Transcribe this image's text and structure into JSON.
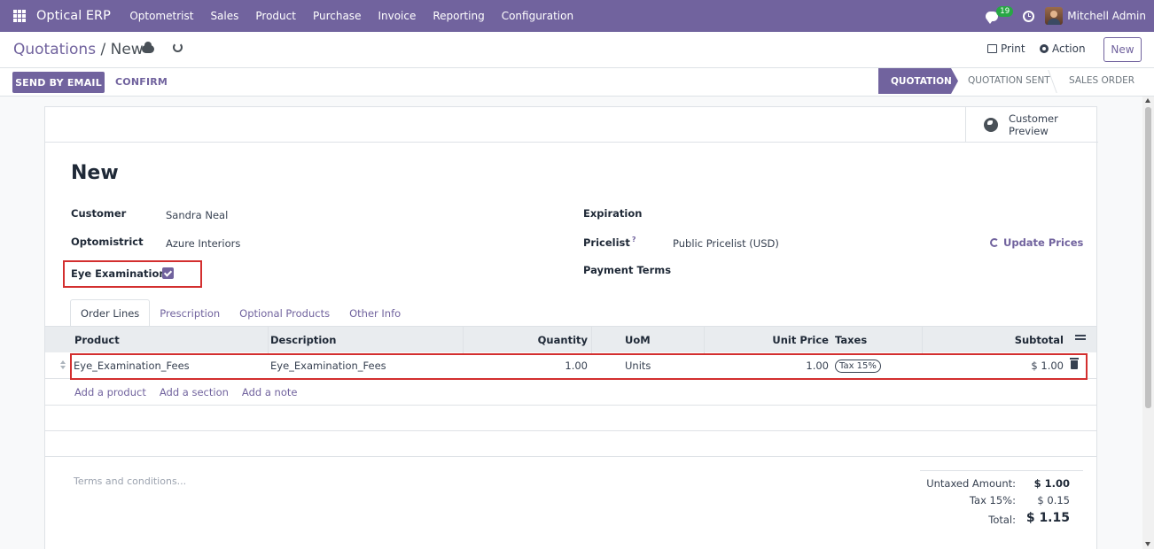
{
  "navbar": {
    "brand": "Optical ERP",
    "menu": [
      "Optometrist",
      "Sales",
      "Product",
      "Purchase",
      "Invoice",
      "Reporting",
      "Configuration"
    ],
    "chat_badge": "19",
    "user_name": "Mitchell Admin"
  },
  "control": {
    "breadcrumb_parent": "Quotations",
    "breadcrumb_sep": " / ",
    "breadcrumb_current": "New",
    "print_label": "Print",
    "action_label": "Action",
    "new_label": "New"
  },
  "statusbar": {
    "send_label": "SEND BY EMAIL",
    "confirm_label": "CONFIRM",
    "stages": [
      "QUOTATION",
      "QUOTATION SENT",
      "SALES ORDER"
    ],
    "active_stage": "QUOTATION"
  },
  "form": {
    "preview_label": "Customer Preview",
    "title": "New",
    "customer_label": "Customer",
    "customer_value": "Sandra Neal",
    "optometrist_label": "Optomistrict",
    "optometrist_value": "Azure Interiors",
    "eye_exam_label": "Eye Examination",
    "eye_exam_checked": true,
    "expiration_label": "Expiration",
    "pricelist_label": "Pricelist",
    "pricelist_help": "?",
    "pricelist_value": "Public Pricelist (USD)",
    "payment_terms_label": "Payment Terms",
    "update_prices_label": "Update Prices"
  },
  "tabs": [
    "Order Lines",
    "Prescription",
    "Optional Products",
    "Other Info"
  ],
  "table": {
    "columns": {
      "product": "Product",
      "description": "Description",
      "quantity": "Quantity",
      "uom": "UoM",
      "unit_price": "Unit Price",
      "taxes": "Taxes",
      "subtotal": "Subtotal"
    },
    "rows": [
      {
        "product": "Eye_Examination_Fees",
        "description": "Eye_Examination_Fees",
        "quantity": "1.00",
        "uom": "Units",
        "unit_price": "1.00",
        "tax": "Tax 15%",
        "subtotal": "$ 1.00"
      }
    ],
    "add_links": [
      "Add a product",
      "Add a section",
      "Add a note"
    ]
  },
  "footer": {
    "terms_placeholder": "Terms and conditions...",
    "untaxed_label": "Untaxed Amount:",
    "untaxed_value": "$ 1.00",
    "tax_label": "Tax 15%:",
    "tax_value": "$ 0.15",
    "total_label": "Total:",
    "total_value": "$ 1.15"
  },
  "colors": {
    "brand": "#71639e",
    "highlight": "#d32f2f",
    "badge": "#28a745"
  }
}
